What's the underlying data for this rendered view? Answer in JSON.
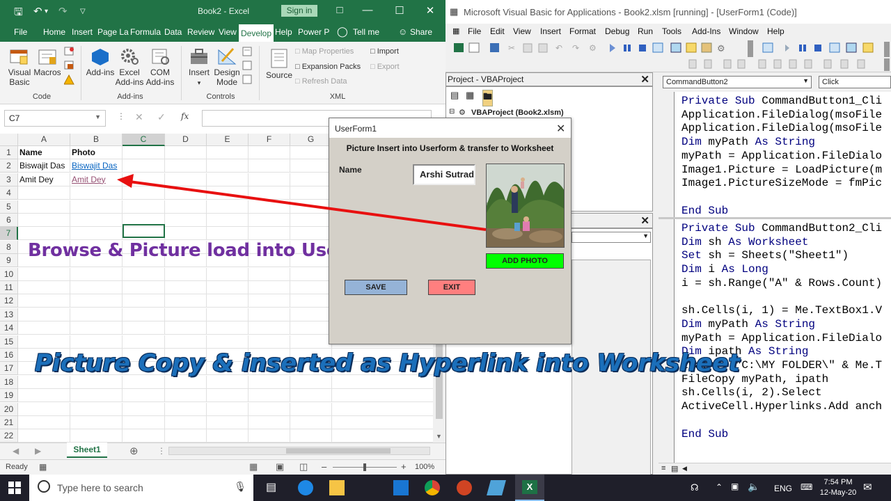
{
  "excel": {
    "doc_title": "Book2 - Excel",
    "signin": "Sign in",
    "tabs": [
      "File",
      "Home",
      "Insert",
      "Page La",
      "Formula",
      "Data",
      "Review",
      "View",
      "Develop",
      "Help",
      "Power P",
      "Tell me",
      "Share"
    ],
    "active_tab": "Develop",
    "ribbon": {
      "visual_basic": "Visual Basic",
      "macros": "Macros",
      "addins": "Add-ins",
      "excel_addins": "Excel Add-ins",
      "com_addins": "COM Add-ins",
      "insert": "Insert",
      "design_mode": "Design Mode",
      "source": "Source",
      "map_properties": "Map Properties",
      "expansion_packs": "Expansion Packs",
      "refresh_data": "Refresh Data",
      "import": "Import",
      "export": "Export",
      "group_code": "Code",
      "group_addins": "Add-ins",
      "group_controls": "Controls",
      "group_xml": "XML"
    },
    "name_box": "C7",
    "fx": "fx",
    "columns": [
      "A",
      "B",
      "C",
      "D",
      "E",
      "F",
      "G"
    ],
    "rows": [
      "1",
      "2",
      "3",
      "4",
      "5",
      "6",
      "7",
      "8",
      "9",
      "10",
      "11",
      "12",
      "13",
      "14",
      "15",
      "16",
      "17",
      "18",
      "19",
      "20",
      "21",
      "22"
    ],
    "cells": {
      "A1": "Name",
      "B1": "Photo",
      "A2": "Biswajit Das",
      "B2": "Biswajit Das",
      "A3": "Amit Dey",
      "B3": "Amit Dey"
    },
    "sheet_tab": "Sheet1",
    "status_ready": "Ready",
    "zoom": "100%"
  },
  "overlay": {
    "line1": "Browse & Picture load into Userform",
    "line2": "Picture Copy & inserted as Hyperlink into Worksheet"
  },
  "vba": {
    "title": "Microsoft Visual Basic for Applications - Book2.xlsm [running] - [UserForm1 (Code)]",
    "menu": [
      "File",
      "Edit",
      "View",
      "Insert",
      "Format",
      "Debug",
      "Run",
      "Tools",
      "Add-Ins",
      "Window",
      "Help"
    ],
    "project_header": "Project - VBAProject",
    "project_root": "VBAProject (Book2.xlsm)",
    "object_combo": "CommandButton2",
    "proc_combo": "Click",
    "code_pane1": [
      "Private Sub CommandButton1_Cli",
      "Application.FileDialog(msoFile",
      "Application.FileDialog(msoFile",
      "Dim myPath As String",
      "myPath = Application.FileDialo",
      "Image1.Picture = LoadPicture(m",
      "Image1.PictureSizeMode = fmPic",
      "",
      "End Sub"
    ],
    "code_pane2": [
      "Private Sub CommandButton2_Cli",
      "Dim sh As Worksheet",
      "Set sh = Sheets(\"Sheet1\")",
      "Dim i As Long",
      "i = sh.Range(\"A\" & Rows.Count)",
      "",
      "sh.Cells(i, 1) = Me.TextBox1.V",
      "Dim myPath As String",
      "myPath = Application.FileDialo",
      "Dim ipath As String",
      "ipath = \"C:\\MY FOLDER\\\" & Me.T",
      "FileCopy myPath, ipath",
      "sh.Cells(i, 2).Select",
      "ActiveCell.Hyperlinks.Add anch",
      "",
      "End Sub"
    ]
  },
  "userform": {
    "title": "UserForm1",
    "header": "Picture Insert into Userform & transfer to Worksheet",
    "name_label": "Name",
    "name_value": "Arshi Sutradhar",
    "add_photo": "ADD PHOTO",
    "save": "SAVE",
    "exit": "EXIT"
  },
  "taskbar": {
    "search_placeholder": "Type here to search",
    "lang": "ENG",
    "time": "7:54 PM",
    "date": "12-May-20"
  },
  "colors": {
    "excel_green": "#217346",
    "overlay_purple": "#7030a0",
    "overlay_blue": "#1b6fba",
    "arrow_red": "#e81010",
    "add_photo_green": "#00ff00",
    "save_blue": "#95b3d7",
    "exit_red": "#ff7f7f"
  }
}
